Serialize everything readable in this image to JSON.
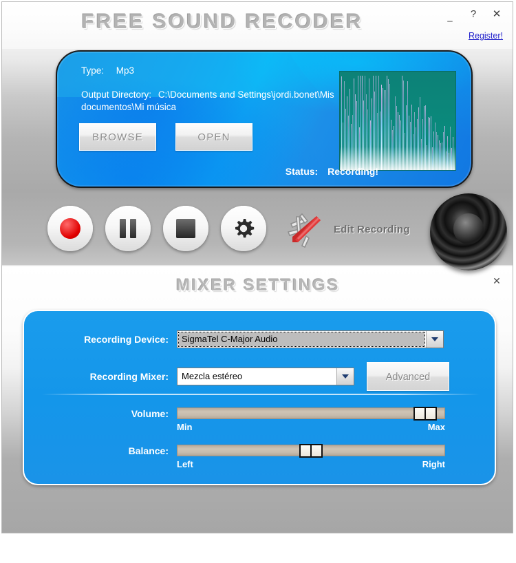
{
  "window": {
    "title": "FREE SOUND RECODER",
    "minimize_label": "_",
    "help_label": "?",
    "close_label": "✕",
    "register_link": "Register!"
  },
  "main_panel": {
    "type_label": "Type:",
    "type_value": "Mp3",
    "output_label": "Output Directory:",
    "output_value": "C:\\Documents and Settings\\jordi.bonet\\Mis documentos\\Mi música",
    "browse_button": "BROWSE",
    "open_button": "OPEN",
    "status_label": "Status:",
    "status_value": "Recording!",
    "panel_color": "#159ae9",
    "visualizer_bg": "#0a8a7c"
  },
  "controls": {
    "record": "record-button",
    "pause": "pause-button",
    "stop": "stop-button",
    "settings": "settings-button",
    "edit_recording_label": "Edit Recording"
  },
  "mixer": {
    "title": "MIXER SETTINGS",
    "close_label": "✕",
    "recording_device_label": "Recording Device:",
    "recording_device_value": "SigmaTel C-Major Audio",
    "recording_mixer_label": "Recording Mixer:",
    "recording_mixer_value": "Mezcla estéreo",
    "advanced_button": "Advanced",
    "volume_label": "Volume:",
    "volume_min_label": "Min",
    "volume_max_label": "Max",
    "volume_percent": 97,
    "balance_label": "Balance:",
    "balance_left_label": "Left",
    "balance_right_label": "Right",
    "balance_percent": 50,
    "panel_color": "#1496ea"
  }
}
